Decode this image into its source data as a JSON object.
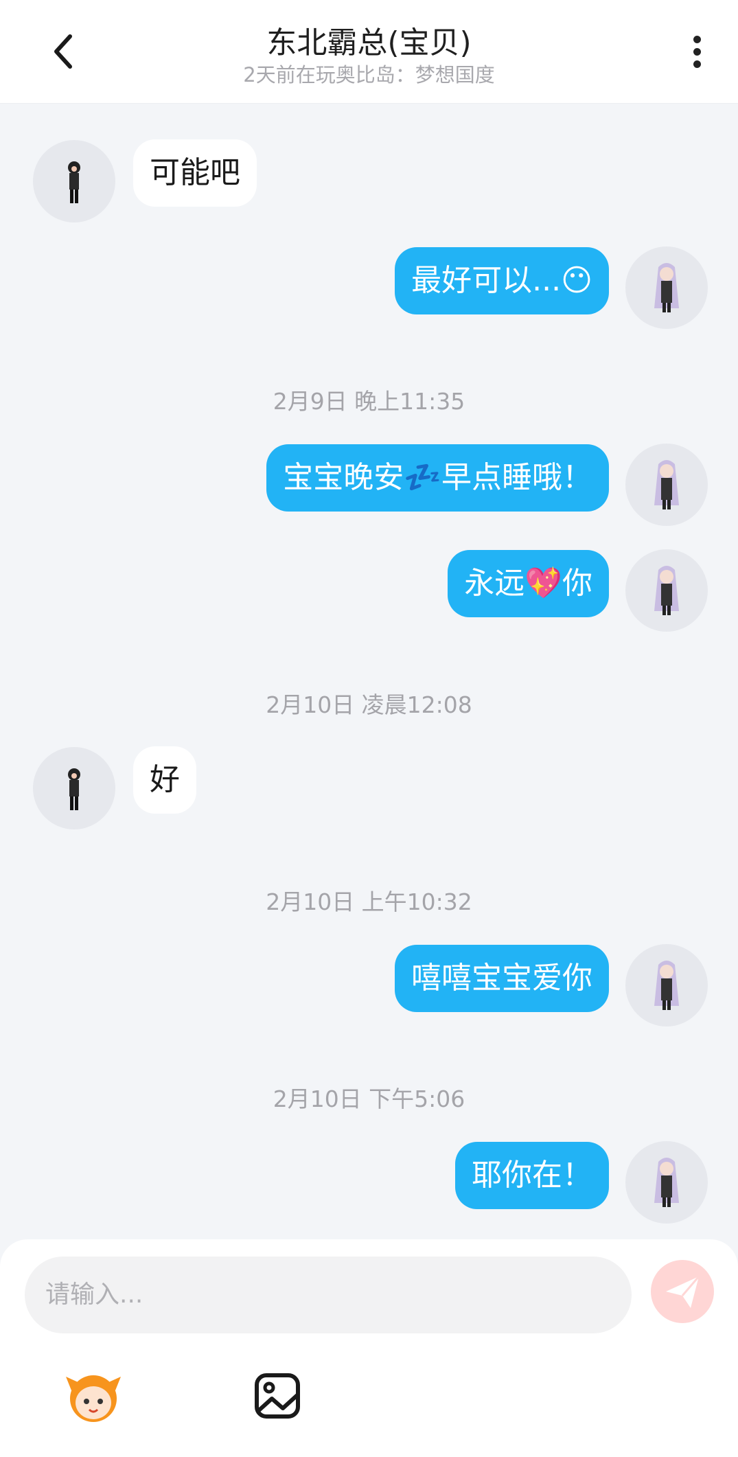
{
  "header": {
    "title": "东北霸总(宝贝)",
    "subtitle": "2天前在玩奥比岛：梦想国度"
  },
  "messages": [
    {
      "side": "in",
      "text": "可能吧"
    },
    {
      "side": "out",
      "text": "最好可以...😶"
    },
    {
      "time": "2月9日 晚上11:35"
    },
    {
      "side": "out",
      "text": "宝宝晚安💤早点睡哦！"
    },
    {
      "side": "out",
      "text": "永远💖你"
    },
    {
      "time": "2月10日 凌晨12:08"
    },
    {
      "side": "in",
      "text": "好"
    },
    {
      "time": "2月10日 上午10:32"
    },
    {
      "side": "out",
      "text": "嘻嘻宝宝爱你"
    },
    {
      "time": "2月10日 下午5:06"
    },
    {
      "side": "out",
      "text": "耶你在！"
    }
  ],
  "composer": {
    "placeholder": "请输入...",
    "send_icon": "paper-plane-icon",
    "tools": [
      "mascot-emoji-icon",
      "image-icon"
    ]
  },
  "colors": {
    "accent": "#22b3f5",
    "background": "#f3f5f8",
    "send_button": "#ffd6d5"
  }
}
